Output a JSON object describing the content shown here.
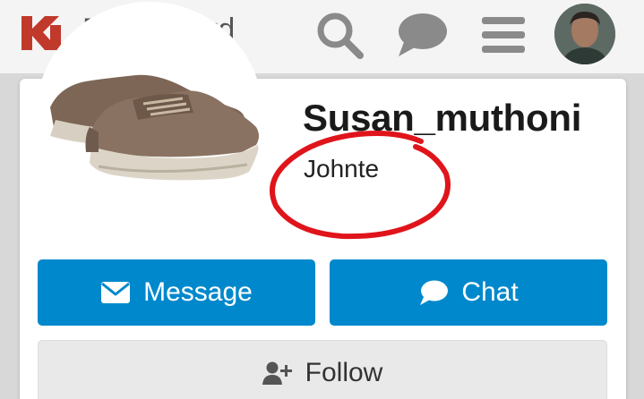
{
  "header": {
    "title": "Dashboard",
    "logo_color": "#c0392b",
    "icon_color": "#8a8a8a",
    "icons": [
      "search-icon",
      "chat-bubble-icon",
      "menu-icon"
    ]
  },
  "profile": {
    "username": "Susan_muthoni",
    "subtitle": "Johnte",
    "picture": "sneaker-product-photo"
  },
  "actions": {
    "message_label": "Message",
    "chat_label": "Chat",
    "follow_label": "Follow"
  },
  "colors": {
    "primary_button": "#0088cc",
    "secondary_button": "#e9e9e9",
    "annotation": "#e0141b"
  }
}
